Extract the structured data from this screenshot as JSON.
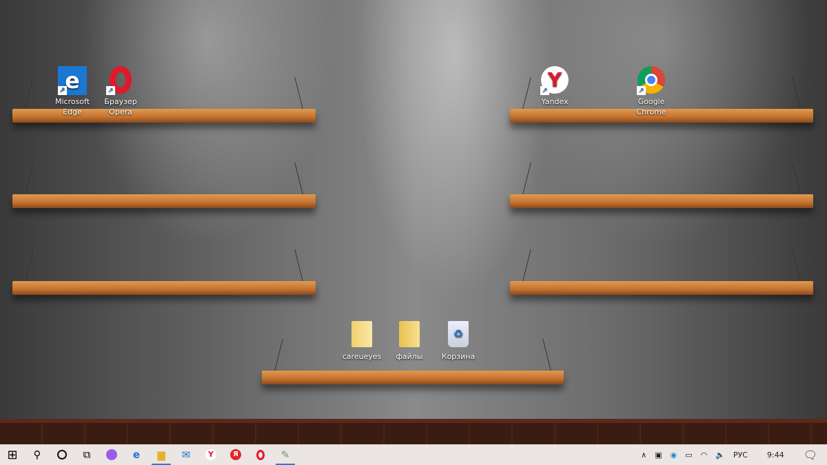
{
  "desktop": {
    "icons": [
      {
        "label": "Microsoft Edge",
        "icon": "edge-icon",
        "shortcut": true
      },
      {
        "label": "Браузер Opera",
        "icon": "opera-icon",
        "shortcut": true
      },
      {
        "label": "Yandex",
        "icon": "yandex-browser-icon",
        "shortcut": true
      },
      {
        "label": "Google Chrome",
        "icon": "chrome-icon",
        "shortcut": true
      },
      {
        "label": "careueyes",
        "icon": "folder-icon",
        "shortcut": false
      },
      {
        "label": "файлы",
        "icon": "folder-icon",
        "shortcut": false
      },
      {
        "label": "Корзина",
        "icon": "recycle-bin-icon",
        "shortcut": false
      }
    ]
  },
  "taskbar": {
    "items": [
      "start-icon",
      "search-icon",
      "cortana-icon",
      "task-view-icon",
      "alice-icon",
      "edge-icon",
      "file-explorer-icon",
      "mail-icon",
      "yandex-browser-icon",
      "yandex-icon",
      "opera-icon",
      "paint-icon"
    ],
    "tray": {
      "language": "РУС",
      "time": "9:44"
    },
    "accent": "#2a7bd4"
  }
}
